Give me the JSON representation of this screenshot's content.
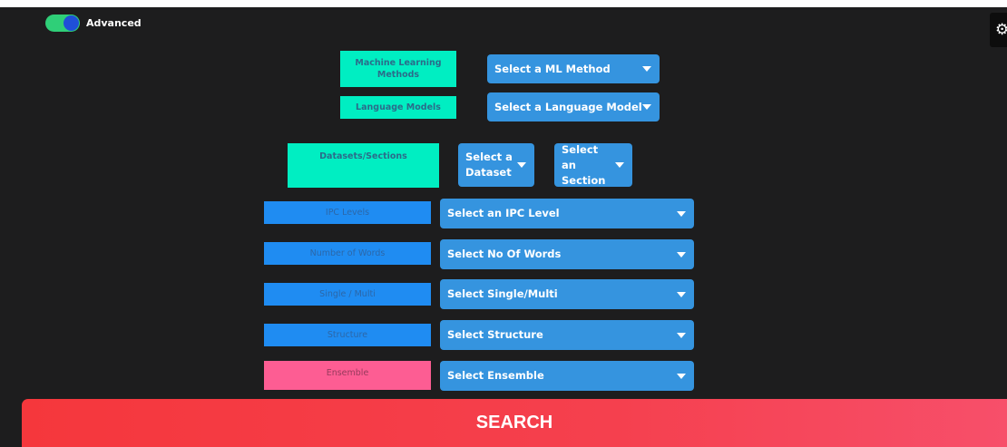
{
  "header": {
    "toggle_label": "Advanced",
    "toggle_on": true,
    "settings_icon": "gear-icon"
  },
  "ml_row": {
    "label": "Machine Learning Methods",
    "select": "Select a ML Method"
  },
  "lm_row": {
    "label": "Language Models",
    "select": "Select a Language Model"
  },
  "datasets_row": {
    "label": "Datasets/Sections",
    "dataset_select": "Select a Dataset",
    "section_select": "Select an Section"
  },
  "ipc_row": {
    "label": "IPC Levels",
    "select": "Select an IPC Level"
  },
  "words_row": {
    "label": "Number of Words",
    "select": "Select No Of Words"
  },
  "single_row": {
    "label": "Single / Multi",
    "select": "Select Single/Multi"
  },
  "structure_row": {
    "label": "Structure",
    "select": "Select Structure"
  },
  "ensemble_row": {
    "label": "Ensemble",
    "select": "Select Ensemble"
  },
  "search_label": "SEARCH",
  "colors": {
    "background": "#1d1d1e",
    "teal_label": "#00eec2",
    "blue_label": "#1f8cf2",
    "pink_label": "#fd5d93",
    "select": "#3594df",
    "search": "#f5373c",
    "toggle_track": "#2fcf78"
  }
}
